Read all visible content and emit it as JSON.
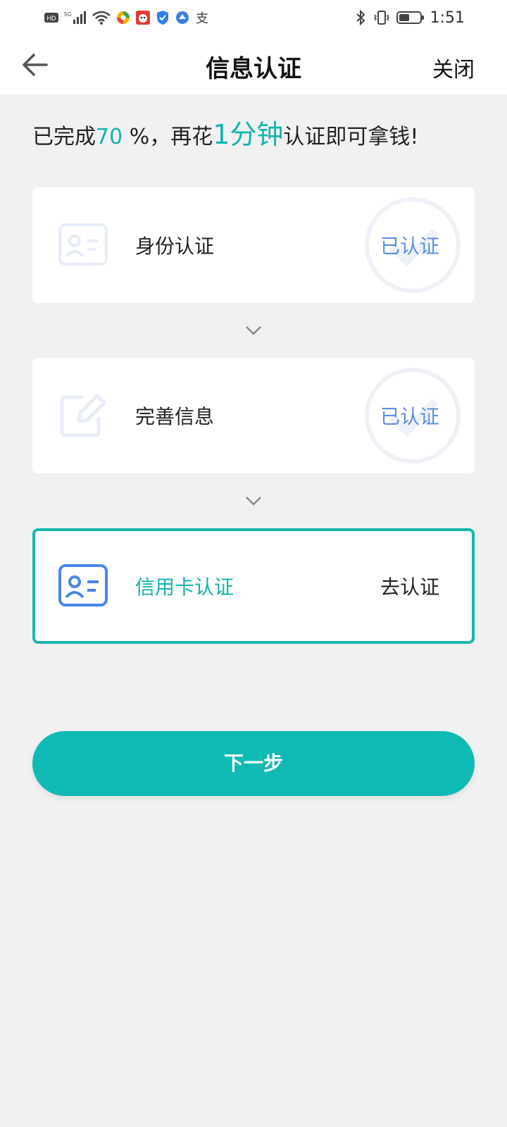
{
  "status_bar": {
    "left_icons": [
      "hd-icon",
      "5g-signal-icon",
      "wifi-icon",
      "app-icon-1",
      "app-icon-2",
      "shield-icon",
      "app-icon-3",
      "alipay-icon"
    ],
    "time": "1:51"
  },
  "nav": {
    "title": "信息认证",
    "close_label": "关闭"
  },
  "progress": {
    "prefix": "已完成",
    "percent": "70",
    "percent_sign": " %，再花",
    "duration": "1分钟",
    "suffix": "认证即可拿钱!"
  },
  "steps": [
    {
      "label": "身份认证",
      "status": "已认证"
    },
    {
      "label": "完善信息",
      "status": "已认证"
    },
    {
      "label": "信用卡认证",
      "action": "去认证"
    }
  ],
  "next_button": {
    "label": "下一步"
  },
  "colors": {
    "accent": "#12b5ae",
    "verified": "#5b8fe0",
    "card_icon_blue": "#4a86e8"
  }
}
